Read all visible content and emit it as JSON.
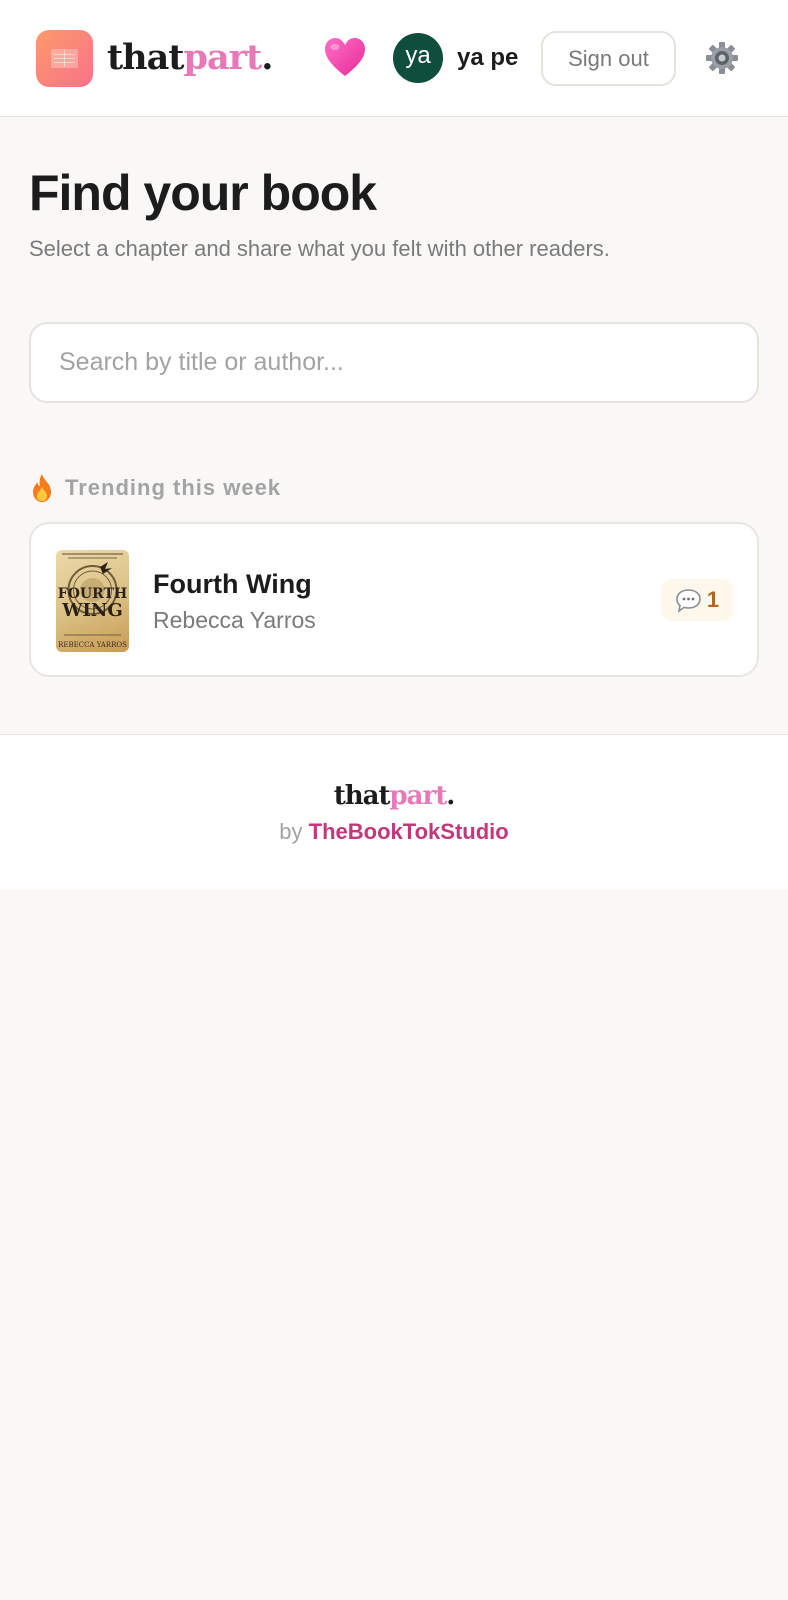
{
  "header": {
    "brand": {
      "part1": "that",
      "part2": "part",
      "part3": "."
    },
    "logo_icon": "open-book-icon",
    "favorites_icon": "pink-heart-icon",
    "user": {
      "avatar_initials": "ya",
      "name": "ya pe"
    },
    "signout_label": "Sign out",
    "settings_icon": "gear-icon"
  },
  "main": {
    "title": "Find your book",
    "subtitle": "Select a chapter and share what you felt with other readers.",
    "search": {
      "placeholder": "Search by title or author...",
      "value": ""
    },
    "trending": {
      "icon": "fire-icon",
      "label": "Trending this week",
      "books": [
        {
          "title": "Fourth Wing",
          "author": "Rebecca Yarros",
          "cover_title_1": "FOURTH",
          "cover_title_2": "WING",
          "cover_author": "REBECCA YARROS",
          "comments_icon": "speech-bubble-icon",
          "comment_count": "1"
        }
      ]
    }
  },
  "footer": {
    "brand": {
      "part1": "that",
      "part2": "part",
      "part3": "."
    },
    "by_label": "by",
    "studio_name": "TheBookTokStudio"
  },
  "colors": {
    "accent_pink": "#e879b9",
    "studio_link": "#c2387a",
    "avatar_bg": "#0f4d3d",
    "page_bg": "#f9f8f6",
    "comment_badge_bg": "#fdf7ec"
  }
}
